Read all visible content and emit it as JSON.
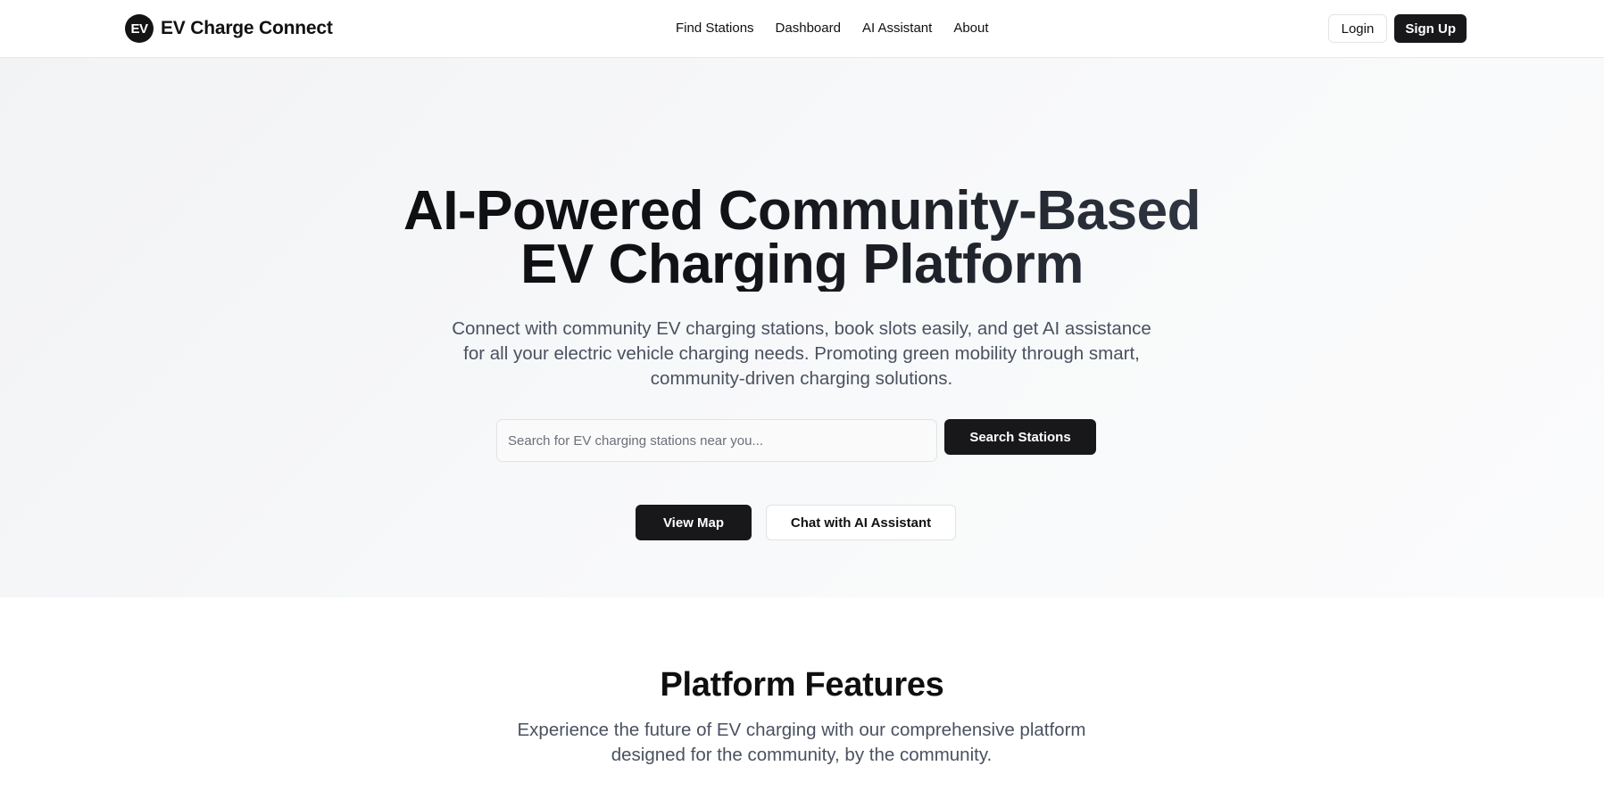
{
  "header": {
    "logo_text": "EV",
    "brand_name": "EV Charge Connect",
    "nav": [
      "Find Stations",
      "Dashboard",
      "AI Assistant",
      "About"
    ],
    "login_label": "Login",
    "signup_label": "Sign Up"
  },
  "hero": {
    "title_line1": "AI-Powered Community-Based",
    "title_line2": "EV Charging Platform",
    "subtitle": "Connect with community EV charging stations, book slots easily, and get AI assistance for all your electric vehicle charging needs. Promoting green mobility through smart, community-driven charging solutions.",
    "search_placeholder": "Search for EV charging stations near you...",
    "search_button": "Search Stations",
    "view_map_button": "View Map",
    "chat_button": "Chat with AI Assistant"
  },
  "features": {
    "title": "Platform Features",
    "subtitle": "Experience the future of EV charging with our comprehensive platform designed for the community, by the community."
  },
  "colors": {
    "primary_dark": "#18181b",
    "muted_text": "#4a5160",
    "border": "#e3e4e8"
  }
}
